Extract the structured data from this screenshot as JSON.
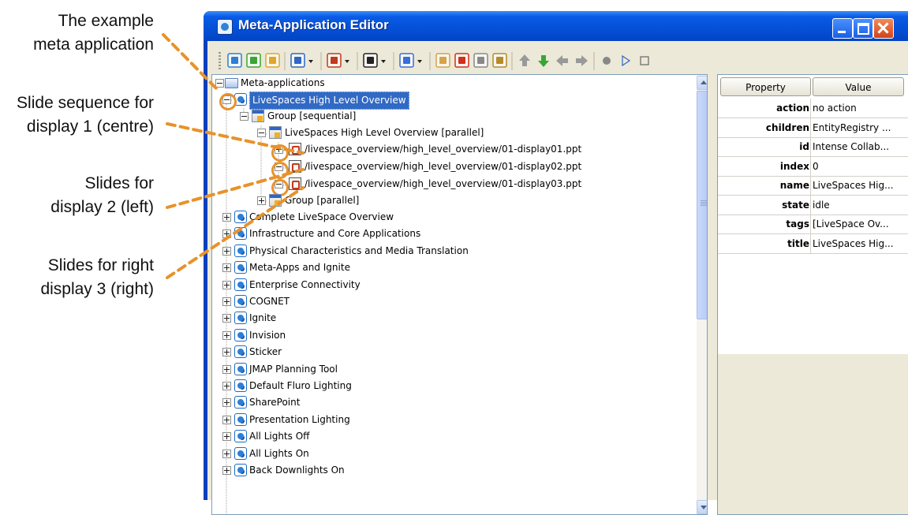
{
  "annotations": [
    {
      "text": "The example\nmeta application"
    },
    {
      "text": "Slide sequence for\ndisplay 1 (centre)"
    },
    {
      "text": "Slides for\ndisplay 2 (left)"
    },
    {
      "text": "Slides for right\ndisplay 3 (right)"
    }
  ],
  "colors": {
    "callout": "#e8922a",
    "titlebar": "#0450d6",
    "selection": "#316ac5"
  },
  "window": {
    "title": "Meta-Application Editor"
  },
  "toolbar": {
    "buttons": [
      "view-icon",
      "download-icon",
      "upload-icon",
      "window-icon",
      "document-icon",
      "terminal-icon",
      "display-icon",
      "scanner-icon",
      "delete-icon",
      "copy-icon",
      "paste-icon",
      "up-arrow-icon",
      "down-arrow-icon",
      "left-arrow-icon",
      "right-arrow-icon",
      "record-icon",
      "play-icon",
      "stop-icon"
    ]
  },
  "tree": {
    "root": "Meta-applications",
    "selected": "LiveSpaces High Level Overview",
    "group_sequential": "Group [sequential]",
    "parallel_node": "LiveSpaces High Level Overview [parallel]",
    "files": [
      "/livespace_overview/high_level_overview/01-display01.ppt",
      "/livespace_overview/high_level_overview/01-display02.ppt",
      "/livespace_overview/high_level_overview/01-display03.ppt"
    ],
    "group_parallel": "Group [parallel]",
    "apps": [
      "Complete LiveSpace Overview",
      "Infrastructure and Core Applications",
      "Physical Characteristics and Media Translation",
      "Meta-Apps and Ignite",
      "Enterprise Connectivity",
      "COGNET",
      "Ignite",
      "Invision",
      "Sticker",
      "JMAP Planning Tool",
      "Default Fluro Lighting",
      "SharePoint",
      "Presentation Lighting",
      "All Lights Off",
      "All Lights On",
      "Back Downlights On"
    ]
  },
  "properties": {
    "header_property": "Property",
    "header_value": "Value",
    "rows": [
      {
        "key": "action",
        "value": "no action"
      },
      {
        "key": "children",
        "value": "EntityRegistry ..."
      },
      {
        "key": "id",
        "value": "Intense Collab..."
      },
      {
        "key": "index",
        "value": "0"
      },
      {
        "key": "name",
        "value": "LiveSpaces Hig..."
      },
      {
        "key": "state",
        "value": "idle"
      },
      {
        "key": "tags",
        "value": "[LiveSpace Ov..."
      },
      {
        "key": "title",
        "value": "LiveSpaces Hig..."
      }
    ]
  }
}
